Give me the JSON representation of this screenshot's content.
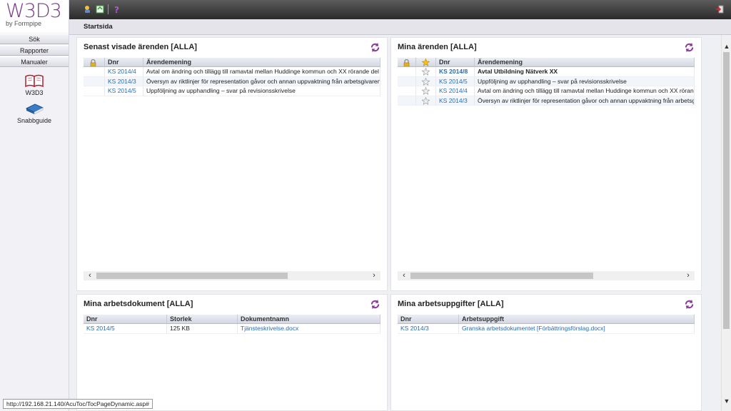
{
  "logo": {
    "main": "W3D3",
    "sub": "by Formpipe"
  },
  "sidebar": {
    "buttons": [
      {
        "label": "Sök"
      },
      {
        "label": "Rapporter"
      },
      {
        "label": "Manualer"
      }
    ],
    "links": [
      {
        "label": "W3D3",
        "icon": "book-icon"
      },
      {
        "label": "Snabbguide",
        "icon": "guide-book-icon"
      }
    ]
  },
  "breadcrumb": {
    "title": "Startsida"
  },
  "panels": {
    "recent": {
      "title": "Senast visade ärenden [ALLA]",
      "columns": [
        "",
        "Dnr",
        "Ärendemening"
      ],
      "rows": [
        {
          "dnr": "KS 2014/4",
          "text": "Avtal om ändring och tillägg till ramavtal mellan Huddinge kommun och XX rörande del av"
        },
        {
          "dnr": "KS 2014/3",
          "text": "Översyn av riktlinjer för representation gåvor och annan uppvaktning från arbetsgivaren"
        },
        {
          "dnr": "KS 2014/5",
          "text": "Uppföljning av upphandling – svar på revisionsskrivelse"
        }
      ]
    },
    "mine": {
      "title": "Mina ärenden [ALLA]",
      "columns": [
        "",
        "",
        "Dnr",
        "Ärendemening"
      ],
      "rows": [
        {
          "dnr": "KS 2014/8",
          "text": "Avtal Utbildning Nätverk XX",
          "bold": true
        },
        {
          "dnr": "KS 2014/5",
          "text": "Uppföljning av upphandling – svar på revisionsskrivelse"
        },
        {
          "dnr": "KS 2014/4",
          "text": "Avtal om ändring och tillägg till ramavtal mellan Huddinge kommun och XX rörande del"
        },
        {
          "dnr": "KS 2014/3",
          "text": "Översyn av riktlinjer för representation gåvor och annan uppvaktning från arbetsgiva"
        }
      ]
    },
    "docs": {
      "title": "Mina arbetsdokument [ALLA]",
      "columns": [
        "Dnr",
        "Storlek",
        "Dokumentnamn"
      ],
      "rows": [
        {
          "dnr": "KS 2014/5",
          "size": "125 KB",
          "name": "Tjänsteskrivelse.docx"
        }
      ]
    },
    "tasks": {
      "title": "Mina arbetsuppgifter [ALLA]",
      "columns": [
        "Dnr",
        "Arbetsuppgift"
      ],
      "rows": [
        {
          "dnr": "KS 2014/3",
          "task": "Granska arbetsdokumentet [Förbättringsförslag.docx]"
        }
      ]
    }
  },
  "statusbar": {
    "url": "http://192.168.21.140/AcuToc/TocPageDynamic.asp#"
  },
  "colors": {
    "accent": "#7a3a8e",
    "link": "#2a6bb0"
  }
}
